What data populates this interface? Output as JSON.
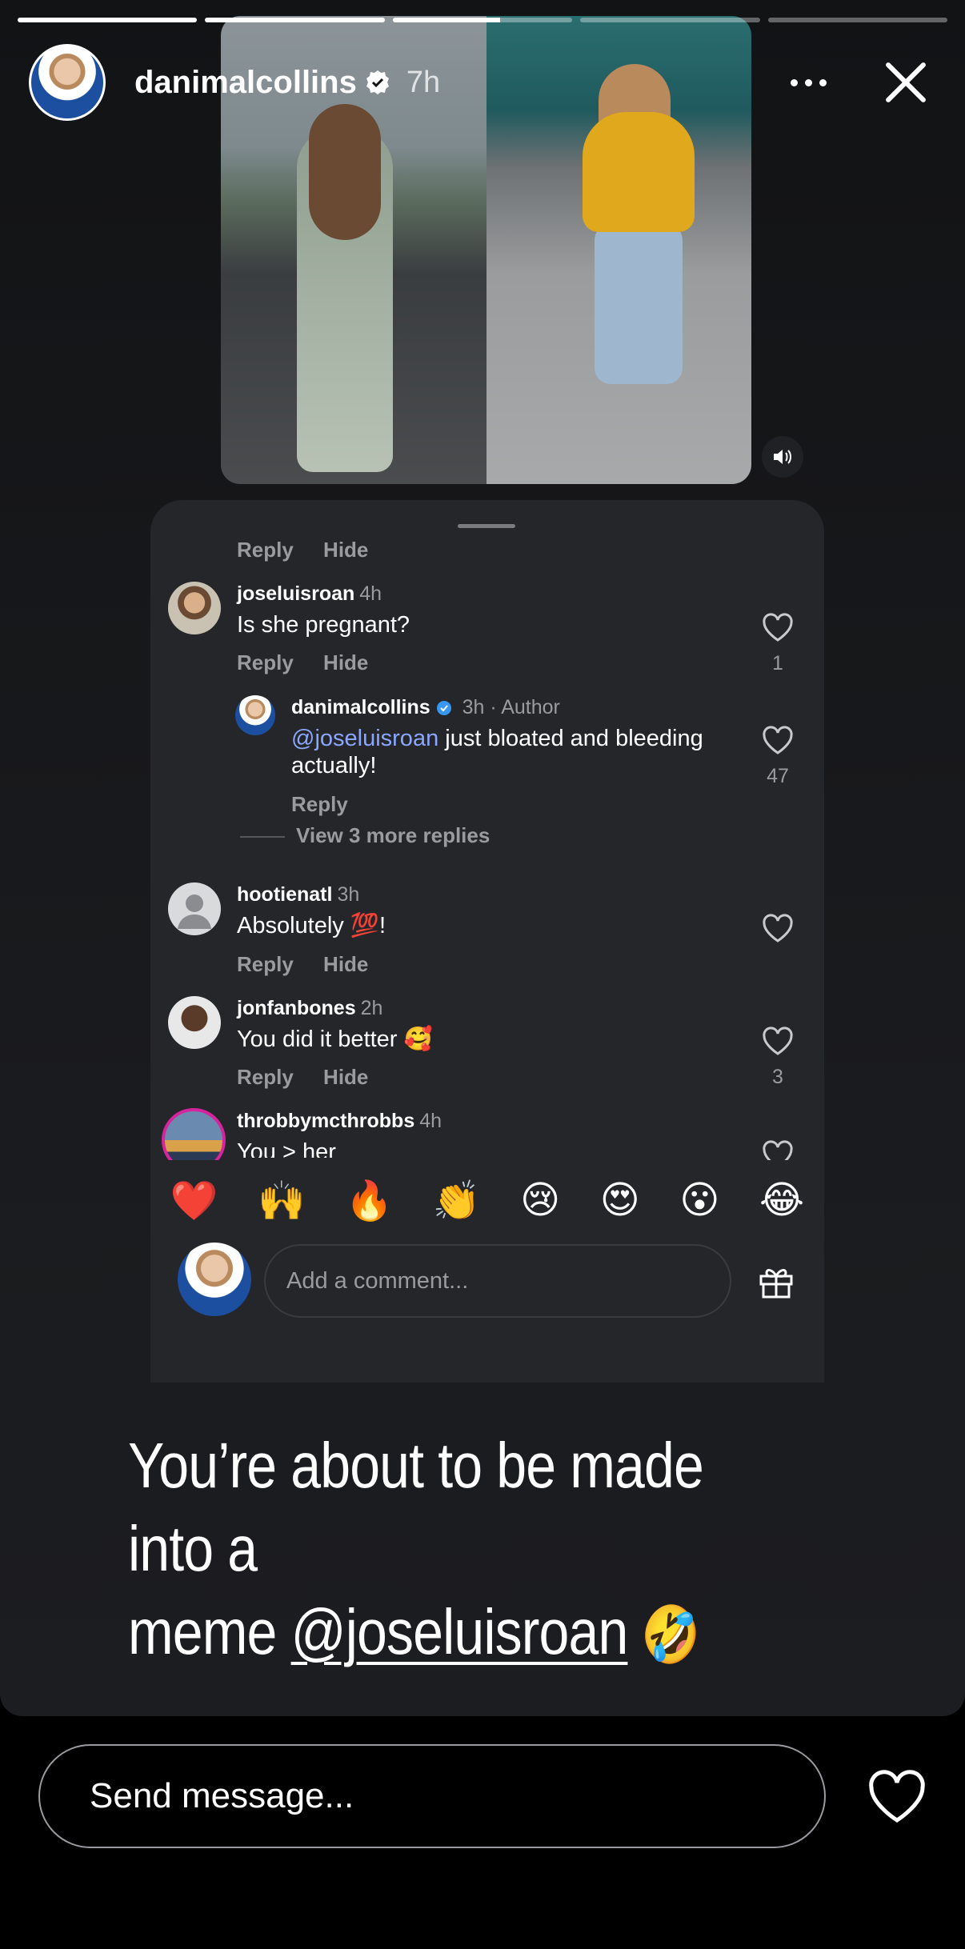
{
  "story": {
    "username": "danimalcollins",
    "time": "7h",
    "progress_segments": [
      1,
      1,
      0.6,
      0,
      0
    ]
  },
  "comments_sheet": {
    "top_actions": {
      "reply": "Reply",
      "hide": "Hide"
    },
    "comments": [
      {
        "username": "joseluisroan",
        "time": "4h",
        "text": "Is she pregnant?",
        "likes": "1",
        "reply": "Reply",
        "hide": "Hide"
      },
      {
        "username": "danimalcollins",
        "time": "3h · Author",
        "mention": "@joseluisroan",
        "text": " just bloated and bleeding actually!",
        "likes": "47",
        "reply": "Reply",
        "view_more": "View 3 more replies"
      },
      {
        "username": "hootienatl",
        "time": "3h",
        "text": "Absolutely 💯!",
        "reply": "Reply",
        "hide": "Hide"
      },
      {
        "username": "jonfanbones",
        "time": "2h",
        "text": "You did it better 🥰",
        "likes": "3",
        "reply": "Reply",
        "hide": "Hide"
      },
      {
        "username": "throbbymcthrobbs",
        "time": "4h",
        "text": "You > her"
      }
    ],
    "reactions": [
      "❤️",
      "🙌",
      "🔥",
      "👏",
      "😢",
      "😍",
      "😮",
      "😂"
    ],
    "comment_placeholder": "Add a comment..."
  },
  "caption": {
    "line1": "You’re about to be made into a",
    "line2_prefix": "meme ",
    "mention": "@joseluisroan",
    "emoji": "🤣"
  },
  "footer": {
    "send_placeholder": "Send message..."
  }
}
